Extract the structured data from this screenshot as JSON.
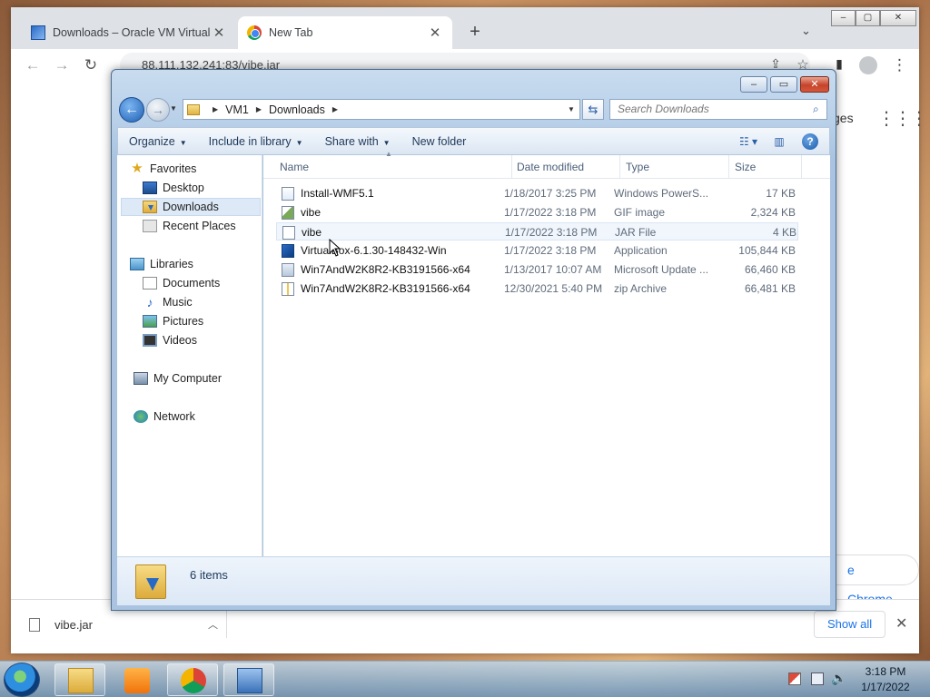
{
  "browser": {
    "tabs": [
      {
        "title": "Downloads – Oracle VM VirtualBox",
        "active": false
      },
      {
        "title": "New Tab",
        "active": true
      }
    ],
    "url": "88.111.132.241:83/vibe.jar",
    "ntp_images_label": "ges",
    "customize_label": "e Chrome",
    "download_bar": {
      "filename": "vibe.jar",
      "show_all": "Show all"
    }
  },
  "explorer": {
    "title": "",
    "breadcrumb": [
      "VM1",
      "Downloads"
    ],
    "search_placeholder": "Search Downloads",
    "commands": {
      "organize": "Organize",
      "include_in_library": "Include in library",
      "share_with": "Share with",
      "new_folder": "New folder"
    },
    "nav": {
      "favorites": "Favorites",
      "desktop": "Desktop",
      "downloads": "Downloads",
      "recent_places": "Recent Places",
      "libraries": "Libraries",
      "documents": "Documents",
      "music": "Music",
      "pictures": "Pictures",
      "videos": "Videos",
      "my_computer": "My Computer",
      "network": "Network"
    },
    "columns": {
      "name": "Name",
      "date": "Date modified",
      "type": "Type",
      "size": "Size"
    },
    "files": [
      {
        "name": "Install-WMF5.1",
        "date": "1/18/2017 3:25 PM",
        "type": "Windows PowerS...",
        "size": "17 KB",
        "icon": "powershell-script-icon"
      },
      {
        "name": "vibe",
        "date": "1/17/2022 3:18 PM",
        "type": "GIF image",
        "size": "2,324 KB",
        "icon": "gif-image-icon"
      },
      {
        "name": "vibe",
        "date": "1/17/2022 3:18 PM",
        "type": "JAR File",
        "size": "4 KB",
        "icon": "jar-file-icon"
      },
      {
        "name": "VirtualBox-6.1.30-148432-Win",
        "date": "1/17/2022 3:18 PM",
        "type": "Application",
        "size": "105,844 KB",
        "icon": "virtualbox-app-icon"
      },
      {
        "name": "Win7AndW2K8R2-KB3191566-x64",
        "date": "1/13/2017 10:07 AM",
        "type": "Microsoft Update ...",
        "size": "66,460 KB",
        "icon": "msu-update-icon"
      },
      {
        "name": "Win7AndW2K8R2-KB3191566-x64",
        "date": "12/30/2021 5:40 PM",
        "type": "zip Archive",
        "size": "66,481 KB",
        "icon": "zip-archive-icon"
      }
    ],
    "status": "6 items"
  },
  "taskbar": {
    "apps": [
      "windows-explorer",
      "media-player",
      "google-chrome",
      "virtualbox"
    ],
    "clock_time": "3:18 PM",
    "clock_date": "1/17/2022"
  }
}
